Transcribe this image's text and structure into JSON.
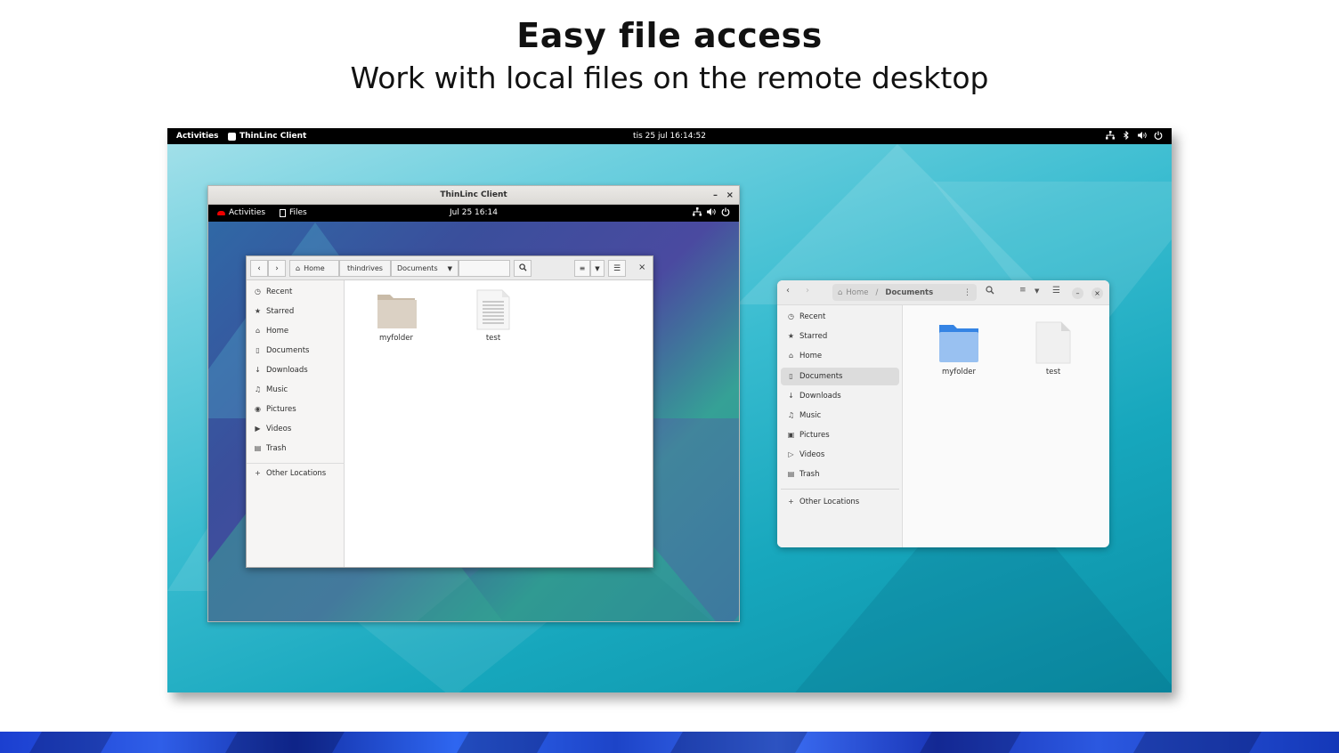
{
  "hero": {
    "title": "Easy file access",
    "subtitle": "Work with local files on the remote desktop"
  },
  "desktop_topbar": {
    "activities": "Activities",
    "app_name": "ThinLinc Client",
    "clock": "tis 25 jul  16:14:52",
    "tray_icons": [
      "network-icon",
      "bluetooth-icon",
      "volume-icon",
      "power-icon"
    ]
  },
  "thinlinc_window": {
    "title": "ThinLinc Client",
    "minimize": "–",
    "close": "×",
    "remote_topbar": {
      "activities": "Activities",
      "app": "Files",
      "clock": "Jul 25  16:14"
    },
    "files": {
      "breadcrumbs": [
        "Home",
        "thindrives",
        "Documents"
      ],
      "sidebar": [
        "Recent",
        "Starred",
        "Home",
        "Documents",
        "Downloads",
        "Music",
        "Pictures",
        "Videos",
        "Trash"
      ],
      "other_locations": "Other Locations",
      "items": [
        {
          "name": "myfolder",
          "icon": "folder-icon"
        },
        {
          "name": "test",
          "icon": "text-file-icon"
        }
      ]
    }
  },
  "local_files_window": {
    "path": {
      "home": "Home",
      "separator": "/",
      "current": "Documents"
    },
    "sidebar": [
      "Recent",
      "Starred",
      "Home",
      "Documents",
      "Downloads",
      "Music",
      "Pictures",
      "Videos",
      "Trash"
    ],
    "selected_sidebar": "Documents",
    "other_locations": "Other Locations",
    "items": [
      {
        "name": "myfolder",
        "icon": "folder-icon"
      },
      {
        "name": "test",
        "icon": "file-icon"
      }
    ],
    "accent_color": "#3584e4"
  }
}
